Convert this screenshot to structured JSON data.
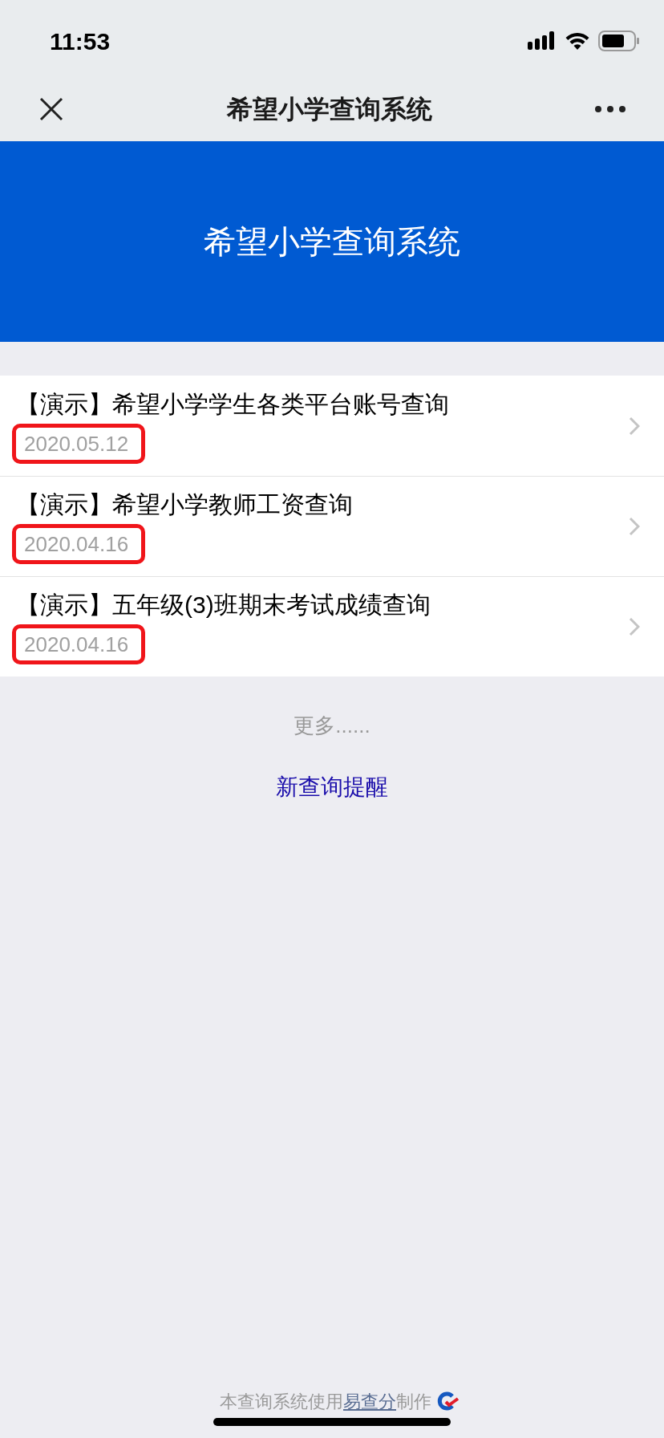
{
  "status_bar": {
    "time": "11:53"
  },
  "nav_bar": {
    "title": "希望小学查询系统"
  },
  "banner": {
    "title": "希望小学查询系统"
  },
  "queries": [
    {
      "title": "【演示】希望小学学生各类平台账号查询",
      "date": "2020.05.12",
      "highlighted": true
    },
    {
      "title": "【演示】希望小学教师工资查询",
      "date": "2020.04.16",
      "highlighted": true
    },
    {
      "title": "【演示】五年级(3)班期末考试成绩查询",
      "date": "2020.04.16",
      "highlighted": true
    }
  ],
  "more": "更多......",
  "reminder_link": "新查询提醒",
  "footer": {
    "before": "本查询系统使用",
    "link": "易查分",
    "after": "制作"
  }
}
